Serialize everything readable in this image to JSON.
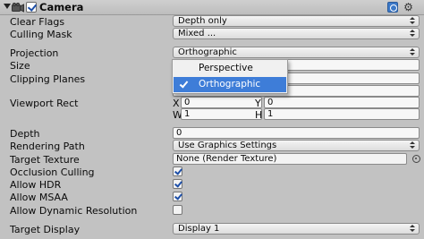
{
  "component": {
    "title": "Camera",
    "enabled": true,
    "icons": [
      "fold-arrow-icon",
      "camera-icon",
      "help-icon",
      "gear-icon"
    ]
  },
  "properties": {
    "clear_flags": {
      "label": "Clear Flags",
      "value": "Depth only"
    },
    "culling_mask": {
      "label": "Culling Mask",
      "value": "Mixed ..."
    },
    "projection": {
      "label": "Projection",
      "value": "Orthographic"
    },
    "size": {
      "label": "Size",
      "value": ""
    },
    "clipping_planes": {
      "label": "Clipping Planes",
      "value": ""
    },
    "viewport_rect": {
      "label": "Viewport Rect",
      "x_label": "X",
      "x": "0",
      "y_label": "Y",
      "y": "0",
      "w_label": "W",
      "w": "1",
      "h_label": "H",
      "h": "1"
    },
    "depth": {
      "label": "Depth",
      "value": "0"
    },
    "rendering_path": {
      "label": "Rendering Path",
      "value": "Use Graphics Settings"
    },
    "target_texture": {
      "label": "Target Texture",
      "value": "None (Render Texture)"
    },
    "occlusion_culling": {
      "label": "Occlusion Culling",
      "checked": true
    },
    "allow_hdr": {
      "label": "Allow HDR",
      "checked": true
    },
    "allow_msaa": {
      "label": "Allow MSAA",
      "checked": true
    },
    "allow_dynamic_resolution": {
      "label": "Allow Dynamic Resolution",
      "checked": false
    },
    "target_display": {
      "label": "Target Display",
      "value": "Display 1"
    }
  },
  "projection_menu": {
    "options": [
      "Perspective",
      "Orthographic"
    ],
    "selected": "Orthographic"
  },
  "colors": {
    "background": "#c2c2c2",
    "selection": "#3e7dd8",
    "check": "#1d4fa8"
  }
}
